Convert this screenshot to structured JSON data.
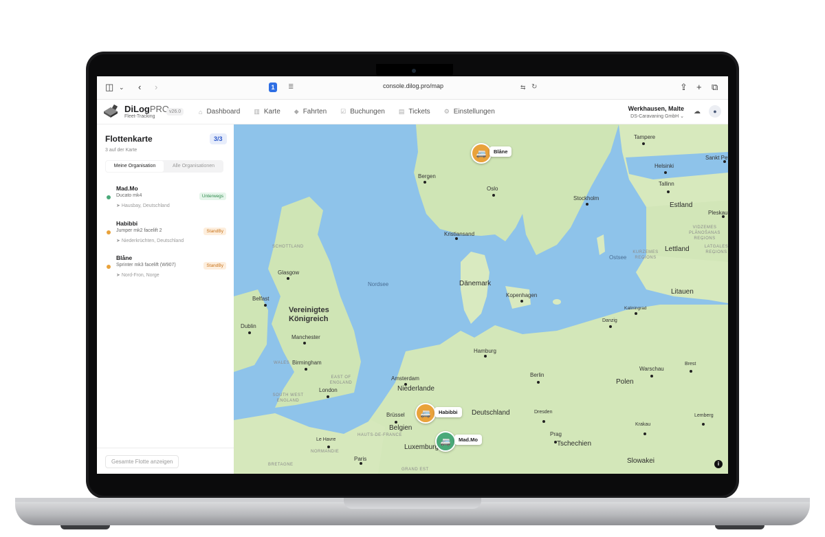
{
  "browser": {
    "url": "console.dilog.pro/map"
  },
  "app": {
    "brand_main": "DiLog",
    "brand_pro": "PRO",
    "brand_sub": "Fleet-Tracking",
    "version": "v26.0",
    "nav": [
      {
        "label": "Dashboard",
        "icon": "home-icon"
      },
      {
        "label": "Karte",
        "icon": "map-icon"
      },
      {
        "label": "Fahrten",
        "icon": "route-icon"
      },
      {
        "label": "Buchungen",
        "icon": "booking-icon"
      },
      {
        "label": "Tickets",
        "icon": "ticket-icon"
      },
      {
        "label": "Einstellungen",
        "icon": "gear-icon"
      }
    ],
    "user_name": "Werkhausen, Malte",
    "user_org": "DS-Caravaning GmbH ⌄"
  },
  "sidebar": {
    "title": "Flottenkarte",
    "count": "3/3",
    "subtitle": "3 auf der Karte",
    "tab_own": "Meine Organisation",
    "tab_all": "Alle Organisationen",
    "vehicles": [
      {
        "name": "Mad.Mo",
        "model": "Ducato mk4",
        "location": "Hausbay, Deutschland",
        "status": "Unterwegs",
        "color": "#4aa979"
      },
      {
        "name": "Habibbi",
        "model": "Jumper mk2 facelift 2",
        "location": "Niederkrüchten, Deutschland",
        "status": "StandBy",
        "color": "#e9a23b"
      },
      {
        "name": "Blåne",
        "model": "Sprinter mk3 facelift (W907)",
        "location": "Nord-Fron, Norge",
        "status": "StandBy",
        "color": "#e9a23b"
      }
    ],
    "footer_button": "Gesamte Flotte anzeigen"
  },
  "map": {
    "sea_labels": [
      "Nordsee",
      "Ostsee"
    ],
    "countries": [
      "Dänemark",
      "Vereinigtes Königreich",
      "Niederlande",
      "Deutschland",
      "Belgien",
      "Luxemburg",
      "Polen",
      "Tschechien",
      "Slowakei",
      "Estland",
      "Lettland",
      "Litauen"
    ],
    "cities": [
      "Tampere",
      "Helsinki",
      "Sankt Pet",
      "Bergen",
      "Oslo",
      "Stockholm",
      "Tallinn",
      "Pleskau",
      "Kristiansand",
      "Glasgow",
      "Belfast",
      "Dublin",
      "Kopenhagen",
      "Manchester",
      "Birmingham",
      "London",
      "Amsterdam",
      "Hamburg",
      "Berlin",
      "Danzig",
      "Kaliningrad",
      "Warschau",
      "Brest",
      "Brüssel",
      "Dresden",
      "Krakau",
      "Lemberg",
      "Prag",
      "Le Havre",
      "Paris"
    ],
    "regions": [
      "SCHOTTLAND",
      "WALES",
      "EAST OF ENGLAND",
      "SOUTH WEST ENGLAND",
      "HAUTS-DE-FRANCE",
      "NORMANDIE",
      "BRETAGNE",
      "GRAND EST",
      "VIDZEMES PLĀNOŠANAS REĢIONS",
      "KURZEMES REĢIONS",
      "LATGALES REĢIONS"
    ],
    "markers": [
      {
        "label": "Blåne",
        "color": "#e9a23b"
      },
      {
        "label": "Habibbi",
        "color": "#e9a23b"
      },
      {
        "label": "Mad.Mo",
        "color": "#4aa979"
      }
    ],
    "info": "i"
  }
}
